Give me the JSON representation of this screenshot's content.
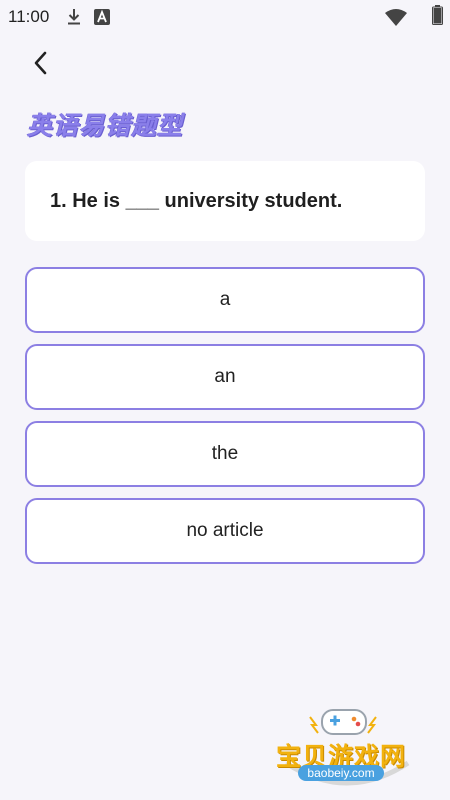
{
  "status_bar": {
    "time": "11:00",
    "icons": [
      "download-icon",
      "keyboard-a-icon",
      "wifi-icon",
      "battery-icon"
    ]
  },
  "header": {
    "back_icon": "chevron-left-icon",
    "title": "英语易错题型"
  },
  "question": {
    "text": "1. He is ___ university student."
  },
  "options": [
    {
      "label": "a"
    },
    {
      "label": "an"
    },
    {
      "label": "the"
    },
    {
      "label": "no article"
    }
  ],
  "watermark": {
    "name": "宝贝游戏网",
    "url": "baobeiy.com"
  },
  "colors": {
    "accent": "#8c7fe3",
    "background": "#f6f5fa",
    "card": "#ffffff"
  }
}
